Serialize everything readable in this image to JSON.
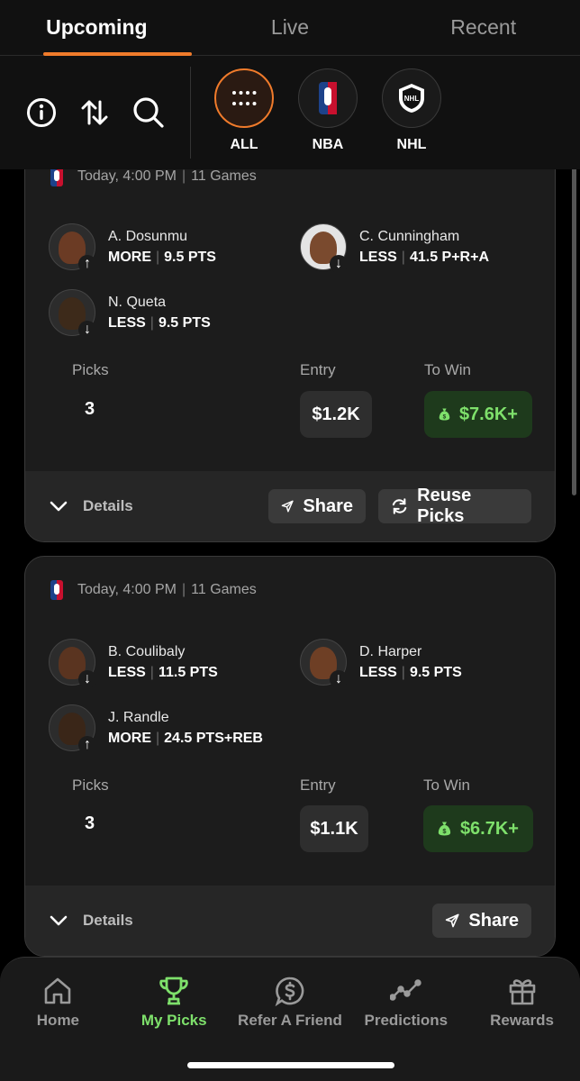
{
  "tabs": [
    {
      "label": "Upcoming",
      "active": true
    },
    {
      "label": "Live",
      "active": false
    },
    {
      "label": "Recent",
      "active": false
    }
  ],
  "toolbar": {
    "icons": [
      "info-icon",
      "sort-icon",
      "search-icon"
    ]
  },
  "leagues": [
    {
      "label": "ALL",
      "icon": "grid-dots-icon",
      "active": true
    },
    {
      "label": "NBA",
      "icon": "nba-logo",
      "active": false
    },
    {
      "label": "NHL",
      "icon": "nhl-logo",
      "active": false
    }
  ],
  "cards": [
    {
      "date": "Today, 4:00 PM",
      "games": "11 Games",
      "players": [
        {
          "name": "A. Dosunmu",
          "direction": "MORE",
          "line": "9.5 PTS",
          "arrow": "↑"
        },
        {
          "name": "C. Cunningham",
          "direction": "LESS",
          "line": "41.5 P+R+A",
          "arrow": "↓"
        },
        {
          "name": "N. Queta",
          "direction": "LESS",
          "line": "9.5 PTS",
          "arrow": "↓"
        }
      ],
      "picks_label": "Picks",
      "picks": "3",
      "entry_label": "Entry",
      "entry": "$1.2K",
      "towin_label": "To Win",
      "towin": "$7.6K+",
      "details_label": "Details",
      "share_label": "Share",
      "reuse_label": "Reuse Picks"
    },
    {
      "date": "Today, 4:00 PM",
      "games": "11 Games",
      "players": [
        {
          "name": "B. Coulibaly",
          "direction": "LESS",
          "line": "11.5 PTS",
          "arrow": "↓"
        },
        {
          "name": "D. Harper",
          "direction": "LESS",
          "line": "9.5 PTS",
          "arrow": "↓"
        },
        {
          "name": "J. Randle",
          "direction": "MORE",
          "line": "24.5 PTS+REB",
          "arrow": "↑"
        }
      ],
      "picks_label": "Picks",
      "picks": "3",
      "entry_label": "Entry",
      "entry": "$1.1K",
      "towin_label": "To Win",
      "towin": "$6.7K+",
      "details_label": "Details",
      "share_label": "Share"
    }
  ],
  "bottom_nav": [
    {
      "label": "Home",
      "icon": "home-icon",
      "active": false
    },
    {
      "label": "My Picks",
      "icon": "trophy-icon",
      "active": true
    },
    {
      "label": "Refer A Friend",
      "icon": "dollar-chat-icon",
      "active": false
    },
    {
      "label": "Predictions",
      "icon": "trend-line-icon",
      "active": false
    },
    {
      "label": "Rewards",
      "icon": "gift-icon",
      "active": false
    }
  ],
  "colors": {
    "accent": "#f07b2b",
    "win_green": "#7ee06b",
    "win_bg": "#1e3a1c"
  }
}
